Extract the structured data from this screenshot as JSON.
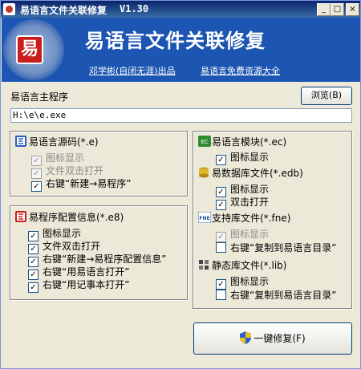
{
  "window": {
    "title": "易语言文件关联修复",
    "version": "V1.30",
    "controls": {
      "minimize": "_",
      "maximize": "□",
      "close": "×"
    }
  },
  "banner": {
    "logo_char": "易",
    "title": "易语言文件关联修复",
    "link_author": "邓学彬(自闭无涯)出品",
    "link_resources": "易语言免费资源大全"
  },
  "main_program": {
    "label": "易语言主程序",
    "browse_label": "浏览(B)",
    "path_value": "H:\\e\\e.exe"
  },
  "source_group": {
    "title": "易语言源码(*.e)",
    "options": [
      {
        "label": "图标显示",
        "checked": true,
        "disabled": true
      },
      {
        "label": "文件双击打开",
        "checked": true,
        "disabled": true
      },
      {
        "label": "右键“新建→易程序”",
        "checked": true,
        "disabled": false
      }
    ]
  },
  "config_group": {
    "title": "易程序配置信息(*.e8)",
    "options": [
      {
        "label": "图标显示",
        "checked": true
      },
      {
        "label": "文件双击打开",
        "checked": true
      },
      {
        "label": "右键“新建→易程序配置信息”",
        "checked": true
      },
      {
        "label": "右键“用易语言打开”",
        "checked": true
      },
      {
        "label": "右键“用记事本打开”",
        "checked": true
      }
    ]
  },
  "right_group": {
    "module": {
      "icon_text": "EC",
      "title": "易语言模块(*.ec)",
      "options": [
        {
          "label": "图标显示",
          "checked": true
        }
      ]
    },
    "database": {
      "title": "易数据库文件(*.edb)",
      "options": [
        {
          "label": "图标显示",
          "checked": true
        },
        {
          "label": "双击打开",
          "checked": true
        }
      ]
    },
    "support": {
      "icon_text": "FNE",
      "title": "支持库文件(*.fne)",
      "options": [
        {
          "label": "图标显示",
          "checked": true,
          "disabled": true
        },
        {
          "label": "右键“复制到易语言目录”",
          "checked": false
        }
      ]
    },
    "static": {
      "title": "静态库文件(*.lib)",
      "options": [
        {
          "label": "图标显示",
          "checked": true
        },
        {
          "label": "右键“复制到易语言目录”",
          "checked": false
        }
      ]
    }
  },
  "fix_button": {
    "label": "一键修复(F)"
  }
}
